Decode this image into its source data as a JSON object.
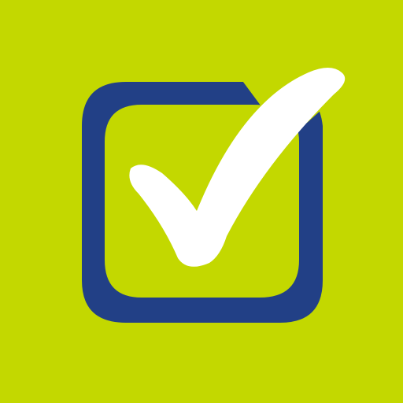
{
  "icon": {
    "name": "checkbox-checked-icon",
    "colors": {
      "background": "#c3d800",
      "box": "#224086",
      "check": "#ffffff"
    }
  }
}
